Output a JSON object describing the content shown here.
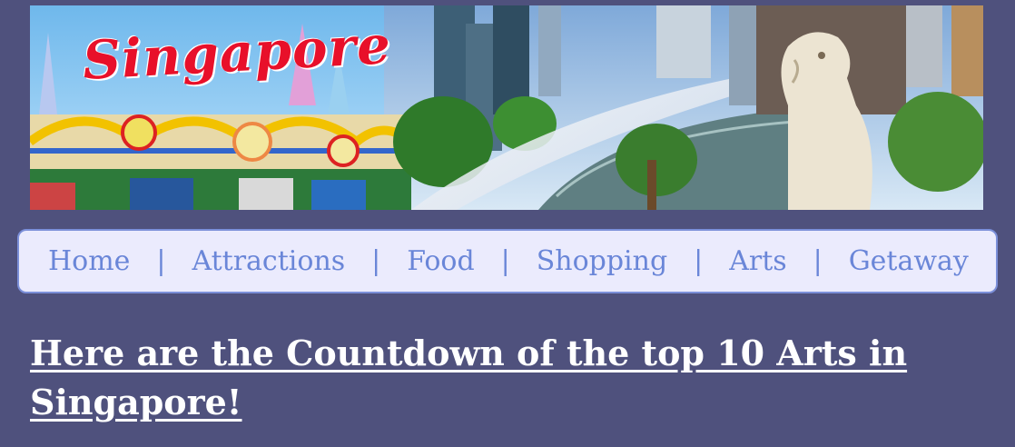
{
  "banner": {
    "logo_text": "Singapore",
    "alt_icon": "singapore-banner-image"
  },
  "nav": {
    "items": [
      {
        "label": "Home"
      },
      {
        "label": "Attractions"
      },
      {
        "label": "Food"
      },
      {
        "label": "Shopping"
      },
      {
        "label": "Arts"
      },
      {
        "label": "Getaway"
      }
    ],
    "separator": "|"
  },
  "main": {
    "title": "Here are the Countdown of the top 10 Arts in Singapore!"
  },
  "colors": {
    "background": "#4f517d",
    "nav_background": "#ebebfd",
    "nav_border": "#7b8fd9",
    "nav_text": "#6a86d8",
    "title_text": "#ffffff"
  }
}
